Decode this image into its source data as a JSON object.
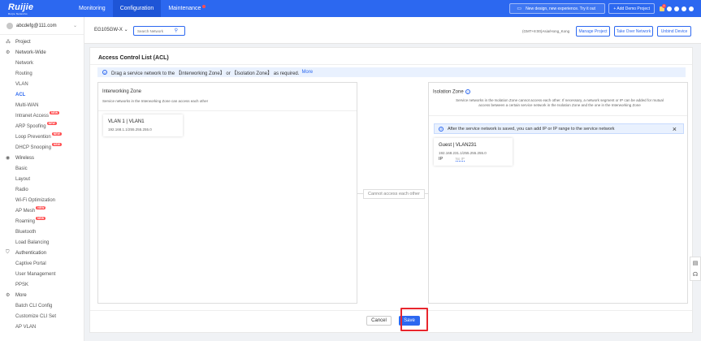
{
  "brand": {
    "name": "Ruijie",
    "tagline": "Ruijie Networks"
  },
  "topnav": [
    {
      "label": "Monitoring"
    },
    {
      "label": "Configuration",
      "active": true
    },
    {
      "label": "Maintenance"
    }
  ],
  "top_right": {
    "banner": "New design, new experience. Try it out",
    "demo": "+ Add Demo Project",
    "notifications": "1"
  },
  "account": {
    "email": "abcdefg@111.com"
  },
  "sidebar": {
    "project": "Project",
    "network_wide": "Network-Wide",
    "network_items": [
      "Network",
      "Routing",
      "VLAN",
      "ACL",
      "Multi-WAN",
      "Intranet Access",
      "ARP Spoofing",
      "Loop Prevention",
      "DHCP Snooping"
    ],
    "new_badge": "NEW",
    "wireless": "Wireless",
    "wireless_items": [
      "Basic",
      "Layout",
      "Radio",
      "Wi-Fi Optimization",
      "AP Mesh",
      "Roaming",
      "Bluetooth",
      "Load Balancing"
    ],
    "authentication": "Authentication",
    "auth_items": [
      "Captive Portal",
      "User Management",
      "PPSK"
    ],
    "more": "More",
    "more_items": [
      "Batch CLI Config",
      "Customize CLI Set",
      "AP VLAN"
    ]
  },
  "subheader": {
    "device": "EG105GW-X",
    "search_placeholder": "Search Network",
    "timezone": "(GMT+8:00)Asia/Hong_Kong",
    "manage_project": "Manage Project",
    "take_over": "Take Over Network",
    "unbind": "Unbind Device"
  },
  "main": {
    "title": "Access Control List (ACL)",
    "info": "Drag a service network to the 【Interworking Zone】 or 【Isolation Zone】 as required.",
    "more_link": "More",
    "interworking": {
      "title": "Interworking Zone",
      "desc": "Service networks in the Interworking Zone can access each other",
      "card": {
        "title": "VLAN 1 | VLAN1",
        "subnet": "192.168.1.1/255.255.255.0"
      }
    },
    "separator": "Cannot access each other",
    "isolation": {
      "title": "Isolation Zone",
      "desc_line1": "Service networks in the Isolation Zone cannot access each other. If necessary, a network segment or IP can be added for mutual",
      "desc_line2": "access between a certain service network in the Isolation Zone and the one in the Interworking Zone",
      "info": "After the service network is saved, you can add IP or IP range to the service network",
      "card": {
        "title": "Guest | VLAN231",
        "subnet": "192.168.231.1/255.255.255.0",
        "ip_label": "IP",
        "ip_value": "No IP"
      }
    },
    "cancel": "Cancel",
    "save": "Save"
  },
  "colors": {
    "primary": "#2c68f0",
    "highlight": "#e8262d",
    "new_badge": "#ff4d4f"
  }
}
